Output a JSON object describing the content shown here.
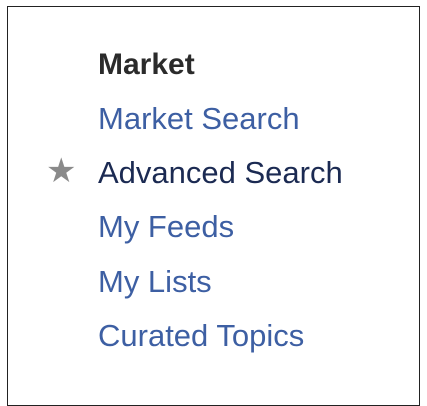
{
  "menu": {
    "heading": "Market",
    "items": [
      {
        "label": "Market Search",
        "current": false
      },
      {
        "label": "Advanced Search",
        "current": true
      },
      {
        "label": "My Feeds",
        "current": false
      },
      {
        "label": "My Lists",
        "current": false
      },
      {
        "label": "Curated Topics",
        "current": false
      }
    ],
    "current_marker_icon": "star-icon",
    "colors": {
      "link": "#3d5fa3",
      "current": "#1b2a52",
      "heading": "#2b2b2b",
      "marker": "#8a8a8a"
    }
  }
}
